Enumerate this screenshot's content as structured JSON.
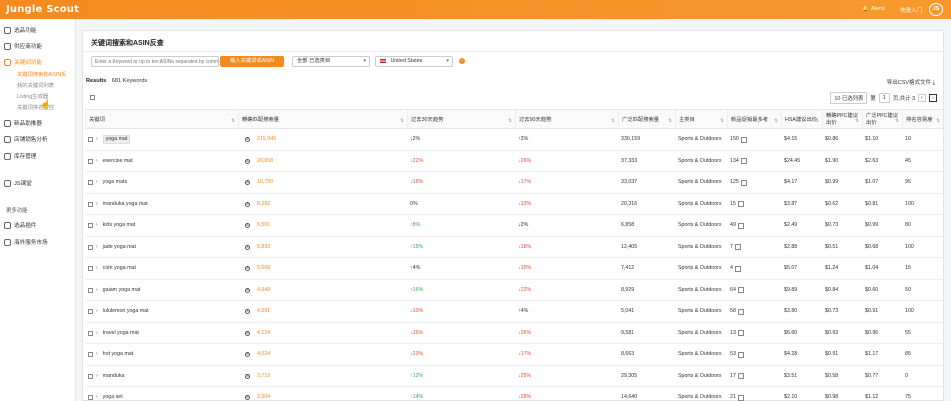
{
  "topbar": {
    "logo": "Jungle Scout",
    "alerts_label": "Alerts",
    "quick_label": "快速入门",
    "avatar_initials": "JS",
    "color": "#f58a1f"
  },
  "sidebar": {
    "items": [
      {
        "label": "选品功能"
      },
      {
        "label": "供应商功能"
      },
      {
        "label": "关键词功能",
        "active": true
      }
    ],
    "subitems": [
      {
        "label": "关键词搜索和ASIN反",
        "active": true
      },
      {
        "label": "我的关键词列表"
      },
      {
        "label": "Listing生成器"
      },
      {
        "label": "关键词排名监控"
      }
    ],
    "items2": [
      {
        "label": "新品助推器"
      },
      {
        "label": "店铺销售分析"
      },
      {
        "label": "库存管理"
      },
      {
        "label": "JS课堂"
      }
    ],
    "more_label": "更多功能",
    "items3": [
      {
        "label": "选品插件"
      },
      {
        "label": "海外服务市场"
      }
    ]
  },
  "page": {
    "title": "关键词搜索和ASIN反查",
    "search_placeholder": "Enter a Keyword or up to ten ASINs separated by commas",
    "search_button": "输入关键词或ASIN",
    "category_select": "全部 已选类目",
    "country_select": "United States",
    "results_label": "Results",
    "results_count": "681 Keywords",
    "export_label": "导出CSV格式文件",
    "page_size": "10 已选列表",
    "page_prefix": "第",
    "page_current": "1",
    "page_suffix": "页,共计 3",
    "prev": "‹",
    "next": "›"
  },
  "table": {
    "headers": [
      "关键词",
      "精确匹配搜索量",
      "过去30天趋势",
      "过去90天趋势",
      "广泛匹配搜索量",
      "主类目",
      "新品促销最多考",
      "HSA建议出价",
      "精确PPC建议出价",
      "广泛PPC建议出价",
      "排名容易度"
    ],
    "rows": [
      {
        "kw": "yoga mat",
        "vol": "215,945",
        "t30": "↓2%",
        "t30c": "down-neutral",
        "t90": "↑3%",
        "t90c": "up-neutral",
        "broad": "330,159",
        "cat": "Sports & Outdoors",
        "giveaways": "150",
        "hsa": "$4.15",
        "exact": "$0.86",
        "broadppc": "$1.10",
        "ease": "10",
        "hl": true
      },
      {
        "kw": "exercise mat",
        "vol": "20,658",
        "t30": "↓22%",
        "t30c": "down",
        "t90": "↓26%",
        "t90c": "down",
        "broad": "37,333",
        "cat": "Sports & Outdoors",
        "giveaways": "134",
        "hsa": "$24.45",
        "exact": "$1.90",
        "broadppc": "$2.63",
        "ease": "45"
      },
      {
        "kw": "yoga mats",
        "vol": "10,750",
        "t30": "↓16%",
        "t30c": "down",
        "t90": "↓17%",
        "t90c": "down",
        "broad": "33,037",
        "cat": "Sports & Outdoors",
        "giveaways": "125",
        "hsa": "$4.17",
        "exact": "$0.99",
        "broadppc": "$1.07",
        "ease": "95"
      },
      {
        "kw": "manduka yoga mat",
        "vol": "8,282",
        "t30": "0%",
        "t30c": "neutral",
        "t90": "↓13%",
        "t90c": "down",
        "broad": "20,316",
        "cat": "Sports & Outdoors",
        "giveaways": "15",
        "hsa": "$3.87",
        "exact": "$0.62",
        "broadppc": "$0.81",
        "ease": "100"
      },
      {
        "kw": "kids yoga mat",
        "vol": "6,501",
        "t30": "↑8%",
        "t30c": "up",
        "t90": "↓2%",
        "t90c": "down-neutral",
        "broad": "6,858",
        "cat": "Sports & Outdoors",
        "giveaways": "49",
        "hsa": "$2.49",
        "exact": "$0.73",
        "broadppc": "$0.99",
        "ease": "80"
      },
      {
        "kw": "jade yoga mat",
        "vol": "5,893",
        "t30": "↑15%",
        "t30c": "up",
        "t90": "↓18%",
        "t90c": "down",
        "broad": "12,405",
        "cat": "Sports & Outdoors",
        "giveaways": "7",
        "hsa": "$2.88",
        "exact": "$0.51",
        "broadppc": "$0.68",
        "ease": "100"
      },
      {
        "kw": "cork yoga mat",
        "vol": "5,068",
        "t30": "↑4%",
        "t30c": "up-neutral",
        "t90": "↓10%",
        "t90c": "down",
        "broad": "7,412",
        "cat": "Sports & Outdoors",
        "giveaways": "4",
        "hsa": "$5.07",
        "exact": "$1.24",
        "broadppc": "$1.04",
        "ease": "15"
      },
      {
        "kw": "gaiam yoga mat",
        "vol": "4,949",
        "t30": "↑16%",
        "t30c": "up",
        "t90": "↓22%",
        "t90c": "down",
        "broad": "8,929",
        "cat": "Sports & Outdoors",
        "giveaways": "64",
        "hsa": "$9.89",
        "exact": "$0.84",
        "broadppc": "$0.60",
        "ease": "50"
      },
      {
        "kw": "lululemon yoga mat",
        "vol": "4,591",
        "t30": "↓10%",
        "t30c": "down",
        "t90": "↑4%",
        "t90c": "up-neutral",
        "broad": "5,041",
        "cat": "Sports & Outdoors",
        "giveaways": "58",
        "hsa": "$3.80",
        "exact": "$0.73",
        "broadppc": "$0.91",
        "ease": "100"
      },
      {
        "kw": "travel yoga mat",
        "vol": "4,124",
        "t30": "↓16%",
        "t30c": "down",
        "t90": "↓26%",
        "t90c": "down",
        "broad": "9,581",
        "cat": "Sports & Outdoors",
        "giveaways": "13",
        "hsa": "$6.60",
        "exact": "$0.93",
        "broadppc": "$0.96",
        "ease": "55"
      },
      {
        "kw": "hot yoga mat",
        "vol": "4,024",
        "t30": "↓23%",
        "t30c": "down",
        "t90": "↓17%",
        "t90c": "down",
        "broad": "8,663",
        "cat": "Sports & Outdoors",
        "giveaways": "53",
        "hsa": "$4.28",
        "exact": "$0.91",
        "broadppc": "$1.17",
        "ease": "85"
      },
      {
        "kw": "manduka",
        "vol": "3,719",
        "t30": "↑12%",
        "t30c": "up",
        "t90": "↓25%",
        "t90c": "down",
        "broad": "29,305",
        "cat": "Sports & Outdoors",
        "giveaways": "17",
        "hsa": "$3.51",
        "exact": "$0.58",
        "broadppc": "$0.77",
        "ease": "0"
      },
      {
        "kw": "yoga set",
        "vol": "3,504",
        "t30": "↑14%",
        "t30c": "up",
        "t90": "↓28%",
        "t90c": "down",
        "broad": "14,640",
        "cat": "Sports & Outdoors",
        "giveaways": "21",
        "hsa": "$2.10",
        "exact": "$0.98",
        "broadppc": "$1.12",
        "ease": "75"
      }
    ]
  }
}
